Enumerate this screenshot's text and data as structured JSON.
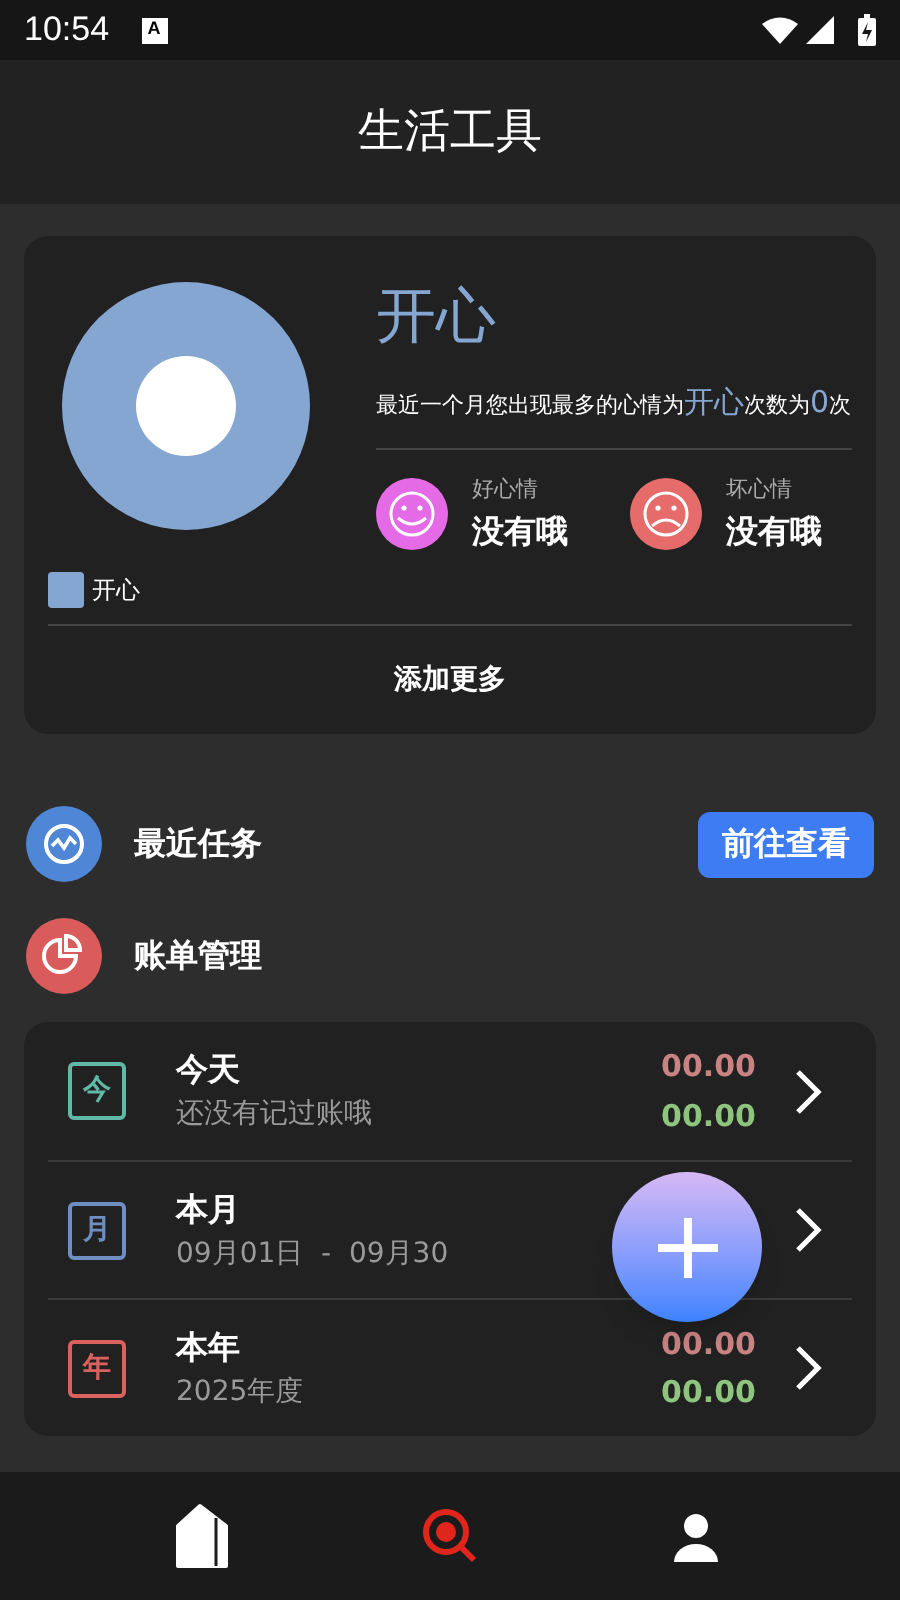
{
  "status_bar": {
    "time": "10:54",
    "notification": "A"
  },
  "header": {
    "title": "生活工具"
  },
  "mood_card": {
    "top_mood": "开心",
    "summary": "最近一个月您出现最多的心情为**开心**次数为**0**次",
    "moods": [
      {
        "kind": "good",
        "label": "好心情",
        "value": "没有哦"
      },
      {
        "kind": "bad",
        "label": "坏心情",
        "value": "没有哦"
      }
    ],
    "legend": [
      {
        "label": "开心",
        "color": "#86a6d2"
      }
    ],
    "add_more": "添加更多"
  },
  "shortcuts": [
    {
      "kind": "tasks",
      "label": "最近任务",
      "button": "前往查看"
    },
    {
      "kind": "bills",
      "label": "账单管理"
    }
  ],
  "bill_rows": [
    {
      "badge": "今",
      "color": "#5fb9a6",
      "title": "今天",
      "subtitle": "还没有记过账哦",
      "expense": "00.00",
      "income": "00.00"
    },
    {
      "badge": "月",
      "color": "#6f8fc2",
      "title": "本月",
      "subtitle": "09月01日  -  09月30"
    },
    {
      "badge": "年",
      "color": "#d9625e",
      "title": "本年",
      "subtitle": "2025年度",
      "expense": "00.00",
      "income": "00.00"
    }
  ],
  "nav": [
    {
      "kind": "home",
      "selected": false
    },
    {
      "kind": "search",
      "selected": true
    },
    {
      "kind": "profile",
      "selected": false
    }
  ]
}
